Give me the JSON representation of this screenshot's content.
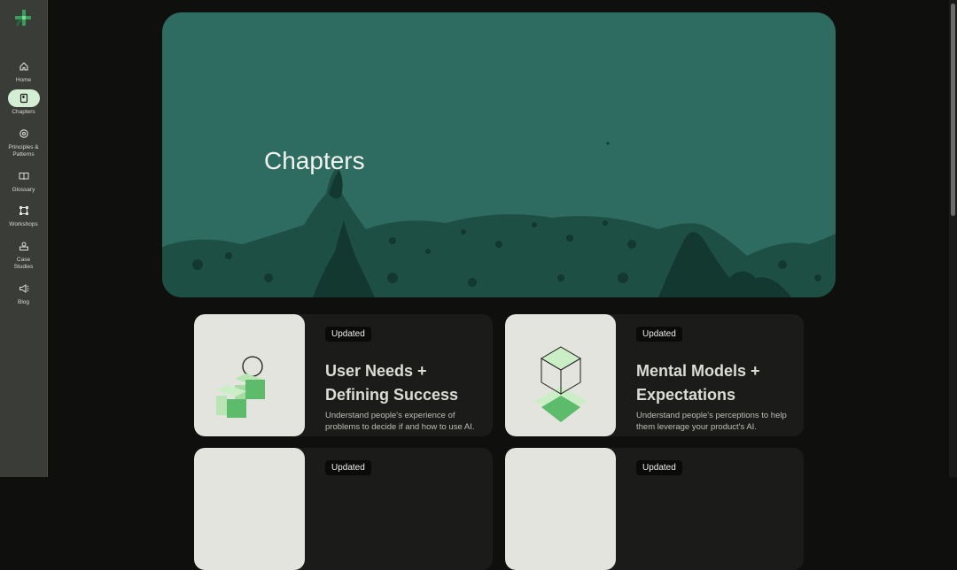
{
  "sidebar": {
    "items": [
      {
        "label": "Home",
        "icon": "home-icon"
      },
      {
        "label": "Chapters",
        "icon": "book-icon",
        "active": true
      },
      {
        "label": "Principles &\nPatterns",
        "icon": "gear-icon"
      },
      {
        "label": "Glossary",
        "icon": "open-book-icon"
      },
      {
        "label": "Workshops",
        "icon": "frame-icon"
      },
      {
        "label": "Case\nStudies",
        "icon": "case-studies-icon"
      },
      {
        "label": "Blog",
        "icon": "megaphone-icon"
      }
    ]
  },
  "hero": {
    "title": "Chapters"
  },
  "cards": [
    {
      "badge": "Updated",
      "title": "User Needs + Defining Success",
      "description": "Understand people's experience of problems to decide if and how to use AI."
    },
    {
      "badge": "Updated",
      "title": "Mental Models + Expectations",
      "description": "Understand people's perceptions to help them leverage your product's AI."
    },
    {
      "badge": "Updated"
    },
    {
      "badge": "Updated"
    }
  ],
  "colors": {
    "accent": "#2e6b61",
    "active_nav": "#d4eed3",
    "card_bg": "#1b1c19"
  }
}
